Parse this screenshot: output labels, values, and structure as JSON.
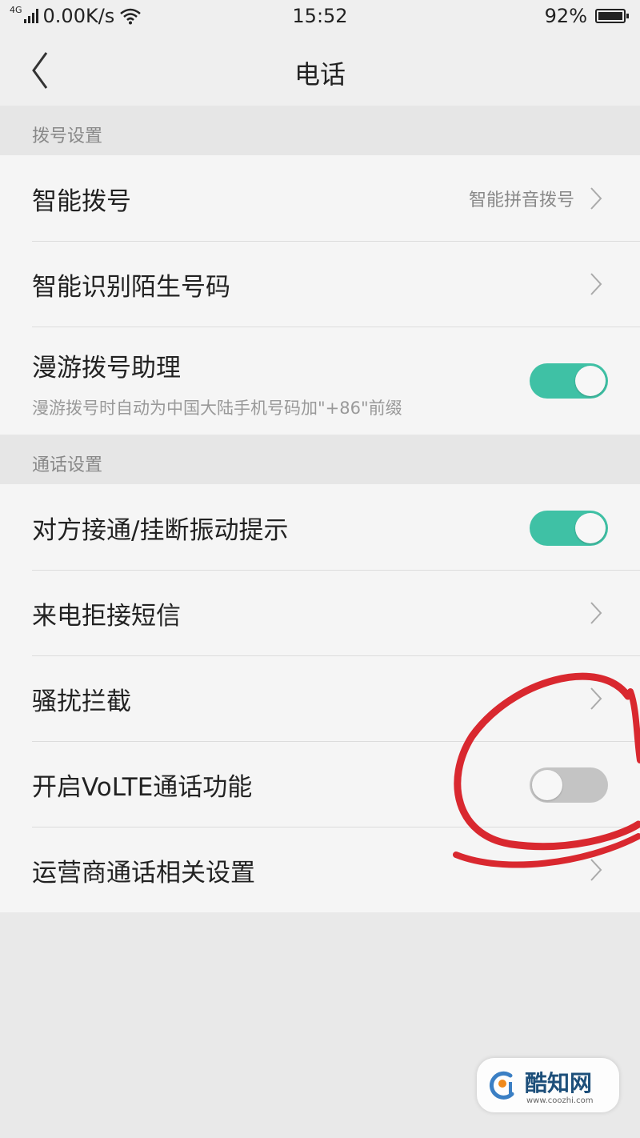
{
  "status_bar": {
    "network_type": "4G",
    "speed": "0.00K/s",
    "time": "15:52",
    "battery": "92%",
    "battery_level": 0.92,
    "icons": [
      "signal-icon",
      "wifi-icon",
      "battery-icon"
    ]
  },
  "nav": {
    "title": "电话",
    "back_icon": "chevron-left-icon"
  },
  "sections": [
    {
      "header": "拨号设置",
      "items": [
        {
          "title": "智能拨号",
          "value": "智能拼音拨号",
          "control": "chevron"
        },
        {
          "title": "智能识别陌生号码",
          "control": "chevron"
        },
        {
          "title": "漫游拨号助理",
          "subtitle": "漫游拨号时自动为中国大陆手机号码加\"+86\"前缀",
          "control": "toggle",
          "checked": true
        }
      ]
    },
    {
      "header": "通话设置",
      "items": [
        {
          "title": "对方接通/挂断振动提示",
          "control": "toggle",
          "checked": true
        },
        {
          "title": "来电拒接短信",
          "control": "chevron"
        },
        {
          "title": "骚扰拦截",
          "control": "chevron"
        },
        {
          "title": "开启VoLTE通话功能",
          "control": "toggle",
          "checked": false
        },
        {
          "title": "运营商通话相关设置",
          "control": "chevron"
        }
      ]
    }
  ],
  "colors": {
    "toggle_on": "#3fc1a5",
    "toggle_off": "#c4c4c4",
    "annotation": "#d9282f",
    "page_bg": "#e9e9e9"
  },
  "watermark": {
    "brand": "酷知网",
    "url": "www.coozhi.com"
  }
}
